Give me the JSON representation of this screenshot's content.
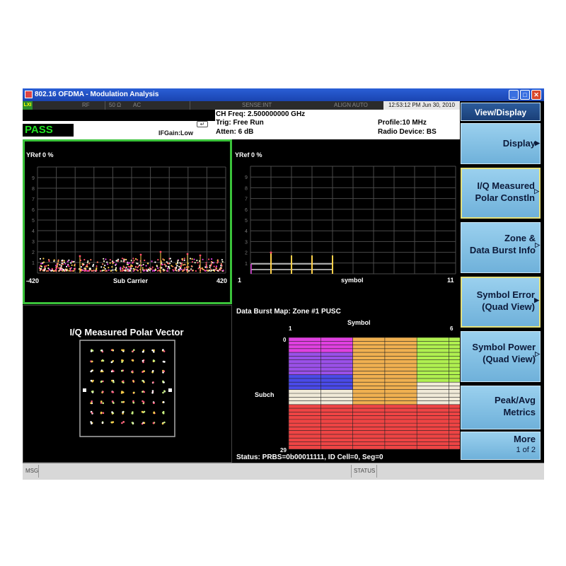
{
  "window": {
    "title": "802.16 OFDMA - Modulation Analysis",
    "controls": [
      "minimize",
      "maximize",
      "close"
    ]
  },
  "status_row": {
    "indicator": "LXI",
    "rf": "RF",
    "impedance": "50 Ω",
    "coupling": "AC",
    "sense": "SENSE:INT",
    "align": "ALIGN AUTO",
    "datetime": "12:53:12 PM Jun 30, 2010"
  },
  "info": {
    "pass": "PASS",
    "ifgain": "IFGain:Low",
    "ch_freq": "CH Freq: 2.500000000 GHz",
    "trig": "Trig: Free Run",
    "atten": "Atten: 6 dB",
    "profile": "Profile:10 MHz",
    "radio_device": "Radio Device: BS"
  },
  "panel_subcarrier": {
    "yref": "YRef  0 %",
    "ticks_y": [
      "9",
      "8",
      "7",
      "6",
      "5",
      "4",
      "3",
      "2",
      "1"
    ],
    "x_start": "-420",
    "x_label": "Sub Carrier",
    "x_end": "420"
  },
  "panel_symbol": {
    "yref": "YRef  0 %",
    "ticks_y": [
      "9",
      "8",
      "7",
      "6",
      "5",
      "4",
      "3",
      "2",
      "1"
    ],
    "x_start": "1",
    "x_label": "symbol",
    "x_end": "11"
  },
  "panel_iq": {
    "title": "I/Q Measured Polar Vector"
  },
  "panel_burstmap": {
    "title": "Data Burst Map: Zone #1 PUSC",
    "symbol_label": "Symbol",
    "symbol_start": "1",
    "symbol_end": "6",
    "row_start": "0",
    "subch_label": "Subch",
    "row_end": "29",
    "status": "Status: PRBS=0b00011111, ID Cell=0, Seg=0",
    "colors": {
      "magenta": "#e040e0",
      "purple": "#9a50e8",
      "blue": "#4a4ae8",
      "orange": "#f0b050",
      "green": "#b0f050",
      "cream": "#f0ead8",
      "red": "#ee4444"
    }
  },
  "softkeys": {
    "header": "View/Display",
    "items": [
      {
        "label1": "Display",
        "label2": "",
        "arrow": "▶"
      },
      {
        "label1": "I/Q Measured",
        "label2": "Polar Constln",
        "arrow": "▷"
      },
      {
        "label1": "Zone &",
        "label2": "Data Burst Info",
        "arrow": "▷"
      },
      {
        "label1": "Symbol Error",
        "label2": "(Quad View)",
        "arrow": "▶"
      },
      {
        "label1": "Symbol Power",
        "label2": "(Quad View)",
        "arrow": "▷"
      },
      {
        "label1": "Peak/Avg",
        "label2": "Metrics",
        "arrow": ""
      },
      {
        "label1": "More",
        "label2": "1 of 2",
        "arrow": ""
      }
    ]
  },
  "bottom_bar": {
    "msg": "MSG",
    "status": "STATUS"
  }
}
